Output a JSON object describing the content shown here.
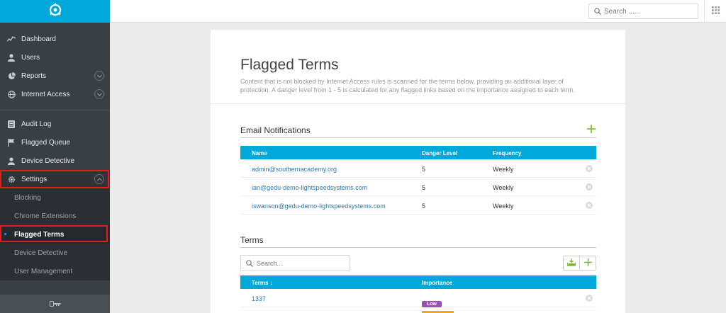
{
  "sidebar": {
    "items": [
      {
        "label": "Dashboard",
        "icon": "activity-icon"
      },
      {
        "label": "Users",
        "icon": "user-icon"
      },
      {
        "label": "Reports",
        "icon": "pie-chart-icon"
      },
      {
        "label": "Internet Access",
        "icon": "globe-icon"
      },
      {
        "label": "Audit Log",
        "icon": "list-icon"
      },
      {
        "label": "Flagged Queue",
        "icon": "flag-icon"
      },
      {
        "label": "Device Detective",
        "icon": "user-icon"
      },
      {
        "label": "Settings",
        "icon": "gear-icon"
      }
    ],
    "subitems": [
      {
        "label": "Blocking"
      },
      {
        "label": "Chrome Extensions"
      },
      {
        "label": "Flagged Terms"
      },
      {
        "label": "Device Detective"
      },
      {
        "label": "User Management"
      }
    ]
  },
  "topbar": {
    "search_placeholder": "Search ......"
  },
  "page": {
    "title": "Flagged Terms",
    "description": "Content that is not blocked by Internet Access rules is scanned for the terms below, providing an additional layer of protection. A danger level from 1 - 5 is calculated for any flagged links based on the importance assigned to each term."
  },
  "email_notifications": {
    "title": "Email Notifications",
    "columns": [
      "Name",
      "Danger Level",
      "Frequency"
    ],
    "rows": [
      {
        "name": "admin@southernacademy.org",
        "danger": "5",
        "frequency": "Weekly"
      },
      {
        "name": "ian@gedu-demo-lightspeedsystems.com",
        "danger": "5",
        "frequency": "Weekly"
      },
      {
        "name": "iswanson@gedu-demo-lightspeedsystems.com",
        "danger": "5",
        "frequency": "Weekly"
      }
    ]
  },
  "terms": {
    "title": "Terms",
    "search_placeholder": "Search...",
    "columns": [
      "Terms ↓",
      "Importance"
    ],
    "rows": [
      {
        "term": "1337",
        "importance": "Low",
        "color": "#9b4fb7"
      }
    ]
  },
  "colors": {
    "accent": "#00a8d9",
    "sidebar": "#3a3f44",
    "add_green": "#7ab829",
    "highlight_red": "#e31c1c"
  }
}
